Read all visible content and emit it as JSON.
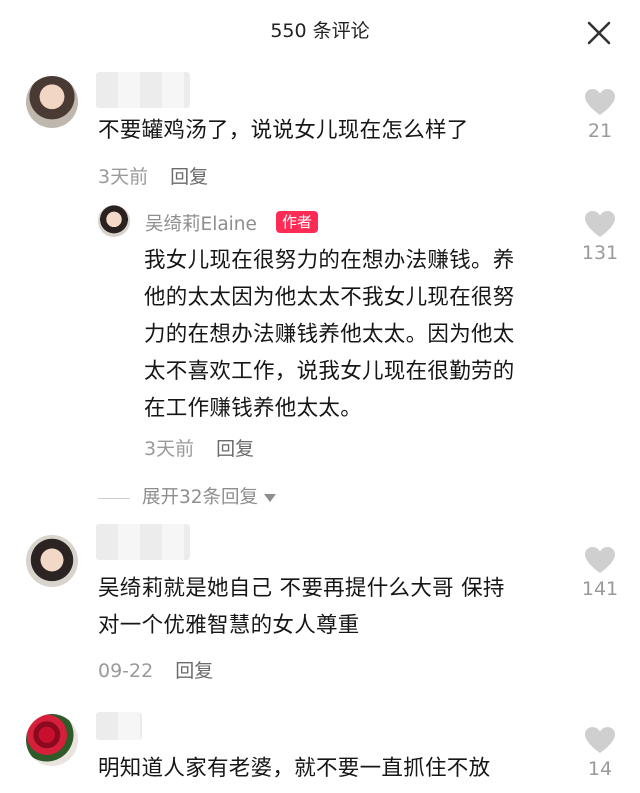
{
  "header": {
    "title": "550 条评论"
  },
  "comments": [
    {
      "text": "不要罐鸡汤了，说说女儿现在怎么样了",
      "time": "3天前",
      "reply_label": "回复",
      "likes": "21"
    },
    {
      "author": "吴绮莉Elaine",
      "badge": "作者",
      "text_lines": [
        "我女儿现在很努力的在想办法赚钱。养",
        "他的太太因为他太太不我女儿现在很努",
        "力的在想办法赚钱养他太太。因为他太",
        "太不喜欢工作，说我女儿现在很勤劳的",
        "在工作赚钱养他太太。"
      ],
      "time": "3天前",
      "reply_label": "回复",
      "likes": "131"
    },
    {
      "expand_label": "展开32条回复"
    },
    {
      "text_lines": [
        "吴绮莉就是她自己 不要再提什么大哥 保持",
        "对一个优雅智慧的女人尊重"
      ],
      "time": "09-22",
      "reply_label": "回复",
      "likes": "141"
    },
    {
      "text": "明知道人家有老婆，就不要一直抓住不放",
      "likes": "14"
    }
  ],
  "colors": {
    "badge": "#fe2c55",
    "heart": "#cfcfcf"
  }
}
